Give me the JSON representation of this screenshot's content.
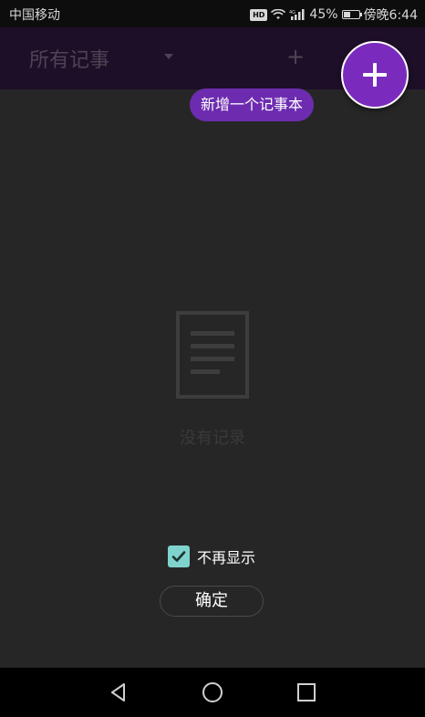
{
  "status_bar": {
    "carrier": "中国移动",
    "hd": "HD",
    "signal": "⁴ᴳ",
    "battery_percent": "45%",
    "battery_level": 0.45,
    "time": "傍晚6:44"
  },
  "toolbar": {
    "title": "所有记事",
    "add_glyph": "+"
  },
  "fab": {
    "tooltip": "新增一个记事本"
  },
  "empty_state": {
    "text": "没有记录"
  },
  "dialog": {
    "checkbox_label": "不再显示",
    "checkbox_checked": true,
    "confirm_label": "确定"
  },
  "colors": {
    "toolbar": "#1e0f28",
    "fab": "#7a2bbd",
    "tooltip": "#6d2cb0",
    "checkbox": "#7fd3cd",
    "background": "#262626"
  }
}
